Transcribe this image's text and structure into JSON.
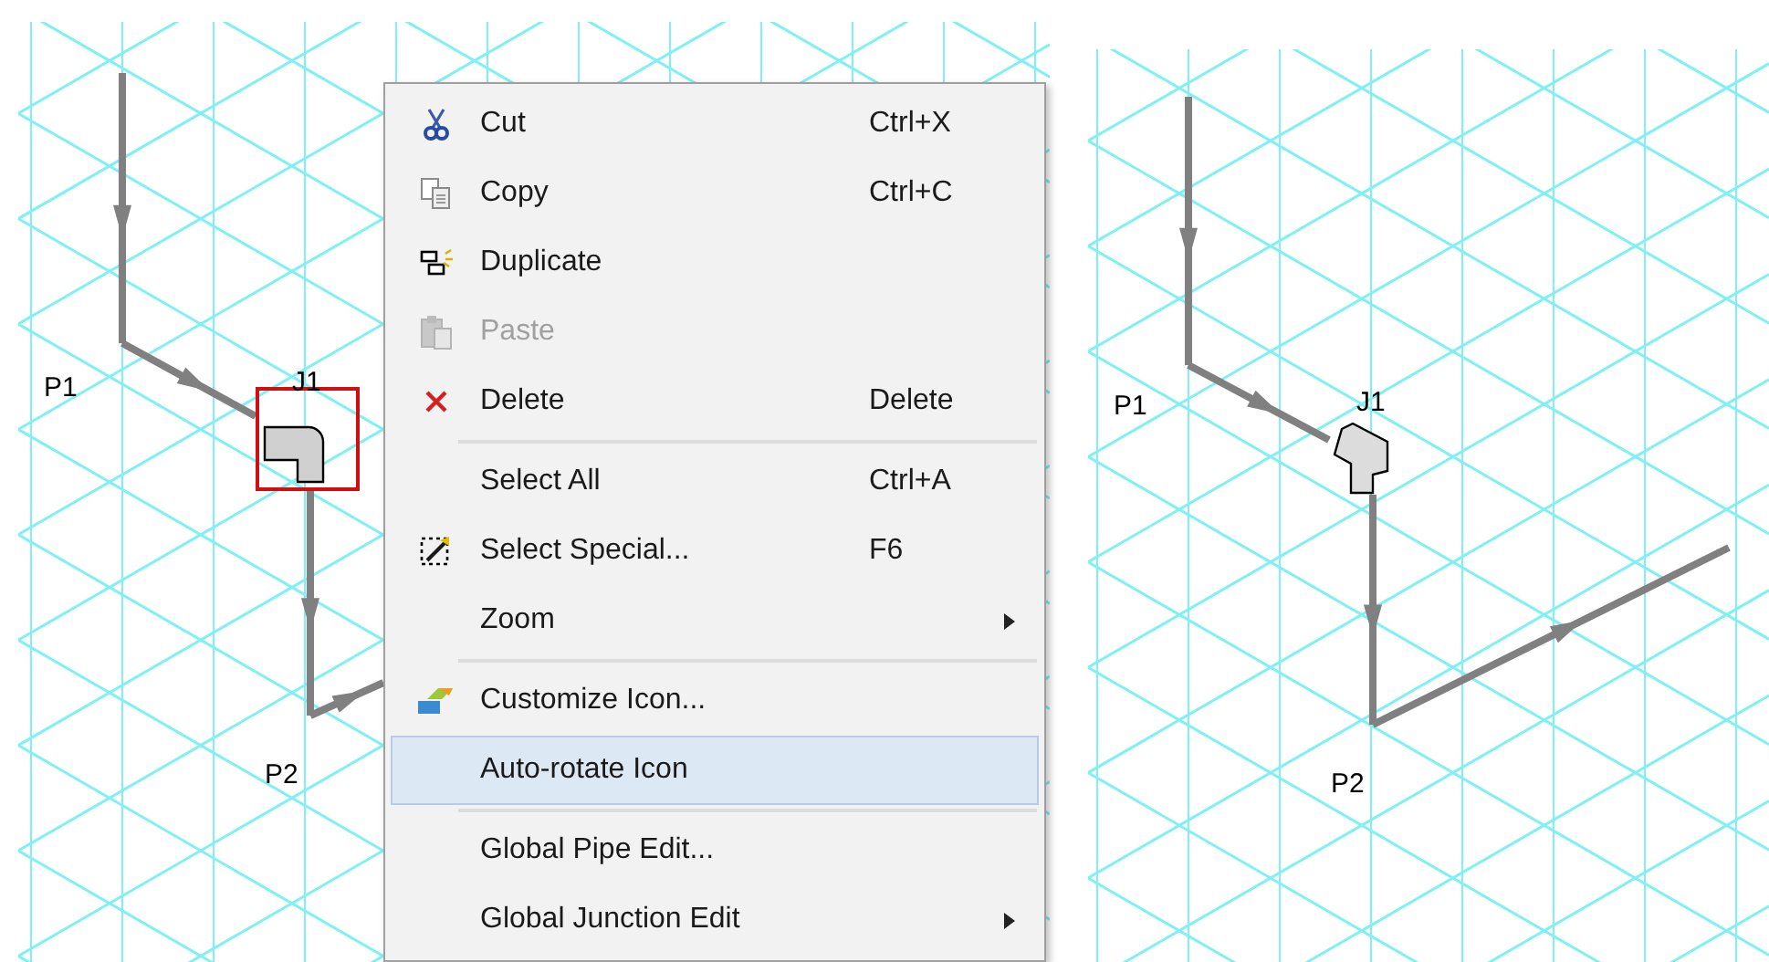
{
  "panels": [
    {
      "labels": [
        {
          "text": "P1"
        },
        {
          "text": "J1"
        },
        {
          "text": "P2"
        }
      ],
      "junction": {
        "selected": true
      }
    },
    {
      "labels": [
        {
          "text": "P1"
        },
        {
          "text": "J1"
        },
        {
          "text": "P2"
        }
      ],
      "junction": {
        "selected": false
      }
    }
  ],
  "context_menu": {
    "items": [
      {
        "kind": "item",
        "label": "Cut",
        "shortcut": "Ctrl+X",
        "disabled": false,
        "selected": false,
        "submenu": false
      },
      {
        "kind": "item",
        "label": "Copy",
        "shortcut": "Ctrl+C",
        "disabled": false,
        "selected": false,
        "submenu": false
      },
      {
        "kind": "item",
        "label": "Duplicate",
        "disabled": false,
        "selected": false,
        "submenu": false
      },
      {
        "kind": "item",
        "label": "Paste",
        "disabled": true,
        "selected": false,
        "submenu": false
      },
      {
        "kind": "item",
        "label": "Delete",
        "shortcut": "Delete",
        "disabled": false,
        "selected": false,
        "submenu": false
      },
      {
        "kind": "separator"
      },
      {
        "kind": "item",
        "label": "Select All",
        "shortcut": "Ctrl+A",
        "disabled": false,
        "selected": false,
        "submenu": false
      },
      {
        "kind": "item",
        "label": "Select Special...",
        "shortcut": "F6",
        "disabled": false,
        "selected": false,
        "submenu": false
      },
      {
        "kind": "item",
        "label": "Zoom",
        "disabled": false,
        "selected": false,
        "submenu": true
      },
      {
        "kind": "separator"
      },
      {
        "kind": "item",
        "label": "Customize Icon...",
        "disabled": false,
        "selected": false,
        "submenu": false
      },
      {
        "kind": "item",
        "label": "Auto-rotate Icon",
        "disabled": false,
        "selected": true,
        "submenu": false
      },
      {
        "kind": "separator"
      },
      {
        "kind": "item",
        "label": "Global Pipe Edit...",
        "disabled": false,
        "selected": false,
        "submenu": false
      },
      {
        "kind": "item",
        "label": "Global Junction Edit",
        "disabled": false,
        "selected": false,
        "submenu": true
      }
    ]
  }
}
